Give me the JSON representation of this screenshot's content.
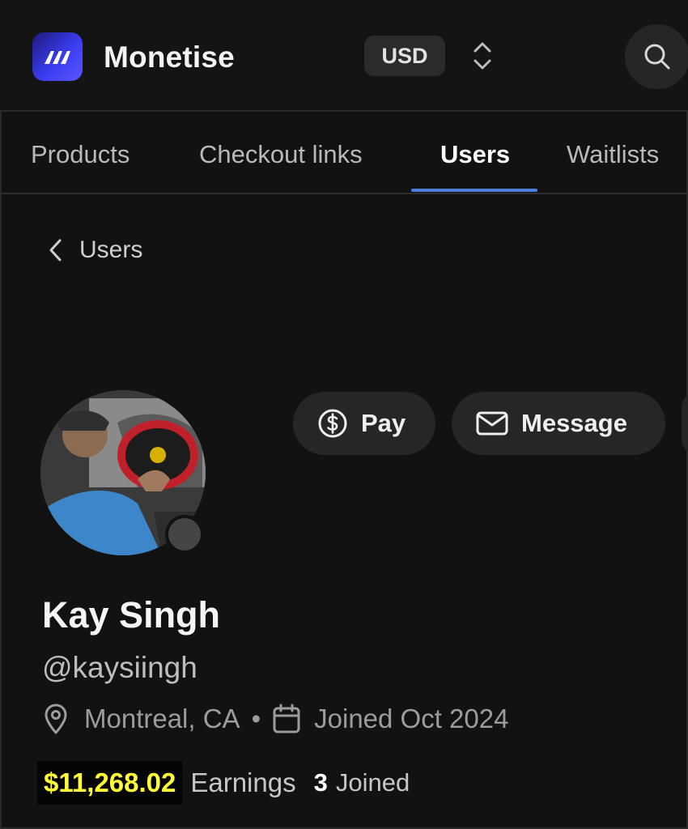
{
  "app": {
    "name": "Monetise",
    "currency": "USD"
  },
  "tabs": [
    {
      "label": "Products",
      "active": false
    },
    {
      "label": "Checkout links",
      "active": false
    },
    {
      "label": "Users",
      "active": true
    },
    {
      "label": "Waitlists",
      "active": false
    }
  ],
  "breadcrumb": {
    "back_label": "Users"
  },
  "actions": {
    "pay_label": "Pay",
    "message_label": "Message"
  },
  "profile": {
    "name": "Kay Singh",
    "handle": "@kaysiingh",
    "location": "Montreal, CA",
    "separator": "•",
    "joined_date": "Joined Oct 2024",
    "earnings_value": "$11,268.02",
    "earnings_label": "Earnings",
    "joined_count": "3",
    "joined_label": "Joined"
  },
  "icons": {
    "logo": "monetise-logo-icon",
    "currency_switch": "chevron-up-down-icon",
    "search": "search-icon",
    "back": "chevron-left-icon",
    "pay": "dollar-circle-icon",
    "message": "mail-icon",
    "location": "map-pin-icon",
    "calendar": "calendar-icon"
  },
  "colors": {
    "accent": "#4a7fe0",
    "earnings_highlight": "#ffff33",
    "background": "#121212"
  }
}
